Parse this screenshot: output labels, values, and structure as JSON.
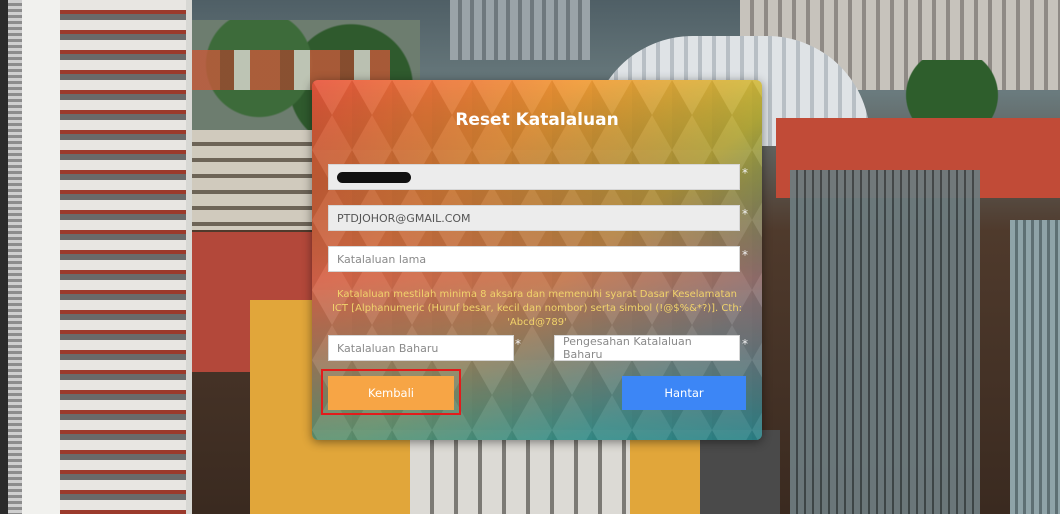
{
  "page": {
    "title": "Reset Katalaluan"
  },
  "form": {
    "username_value": "",
    "email_value": "PTDJOHOR@GMAIL.COM",
    "old_password_placeholder": "Katalaluan lama",
    "password_rule_text": "Katalaluan mestilah minima 8 aksara dan memenuhi syarat Dasar Keselamatan ICT [Alphanumeric (Huruf besar, kecil dan nombor) serta simbol (!@$%&*?)]. Cth: 'Abcd@789'",
    "new_password_placeholder": "Katalaluan Baharu",
    "confirm_password_placeholder": "Pengesahan Katalaluan Baharu",
    "required_marker": "*"
  },
  "buttons": {
    "back_label": "Kembali",
    "submit_label": "Hantar"
  },
  "colors": {
    "back_button": "#f7a545",
    "submit_button": "#3c86f6",
    "highlight_border": "#e31b1b",
    "notice_text": "#f1d36b"
  },
  "icons": {
    "required": "asterisk"
  }
}
